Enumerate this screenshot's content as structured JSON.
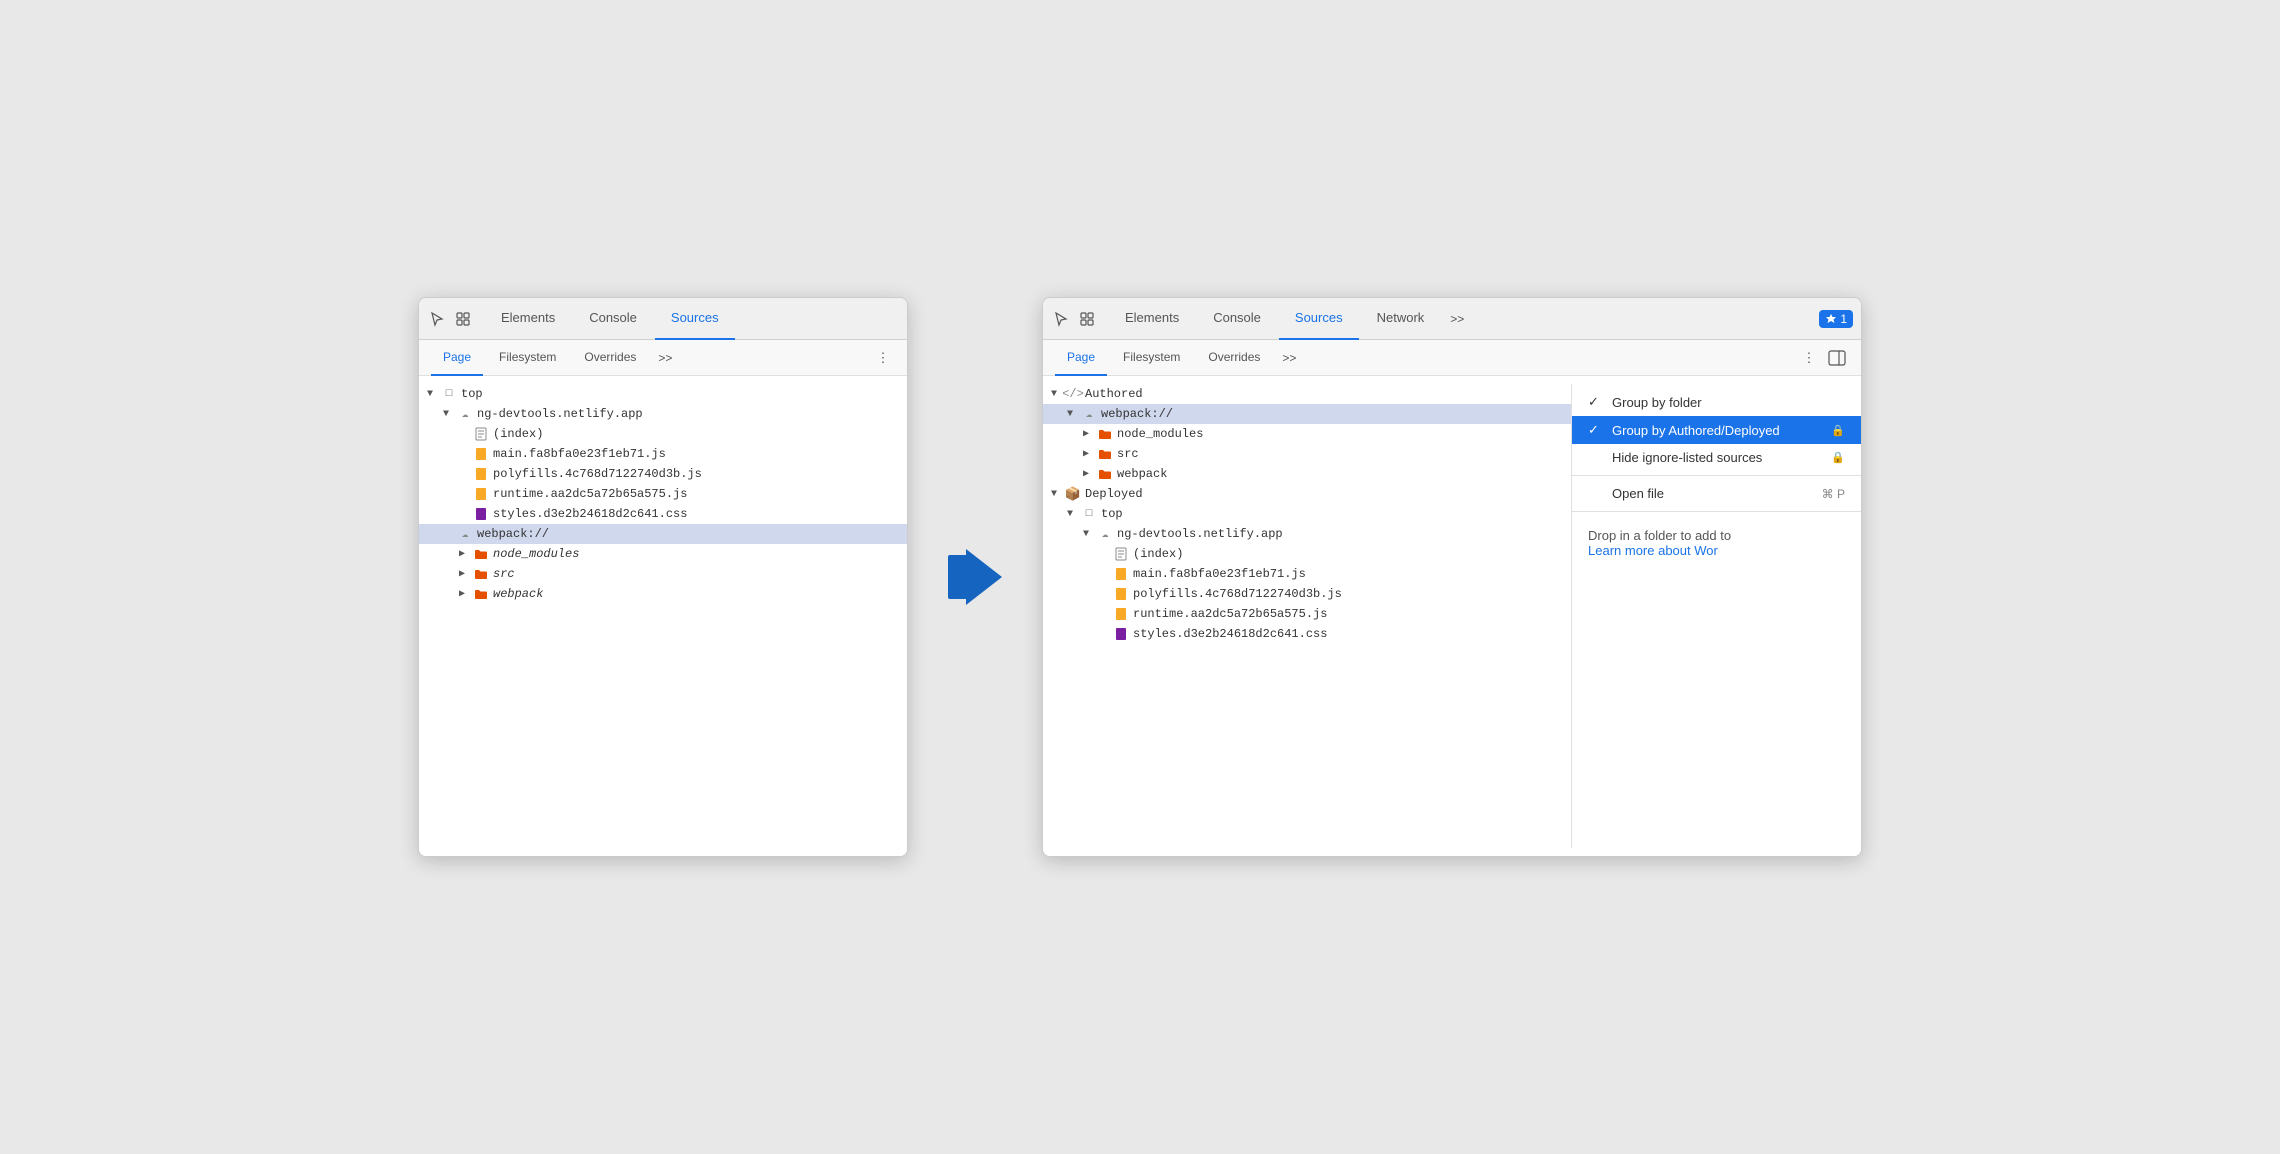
{
  "left_panel": {
    "toolbar": {
      "tabs": [
        "Elements",
        "Console",
        "Sources"
      ],
      "active_tab": "Sources"
    },
    "sub_toolbar": {
      "tabs": [
        "Page",
        "Filesystem",
        "Overrides"
      ],
      "active_tab": "Page",
      "more": ">>"
    },
    "tree": [
      {
        "level": 0,
        "type": "arrow-open",
        "icon": "square",
        "label": "top"
      },
      {
        "level": 1,
        "type": "arrow-open",
        "icon": "cloud",
        "label": "ng-devtools.netlify.app"
      },
      {
        "level": 2,
        "type": "none",
        "icon": "page",
        "label": "(index)"
      },
      {
        "level": 2,
        "type": "none",
        "icon": "js-yellow",
        "label": "main.fa8bfa0e23f1eb71.js"
      },
      {
        "level": 2,
        "type": "none",
        "icon": "js-yellow",
        "label": "polyfills.4c768d7122740d3b.js"
      },
      {
        "level": 2,
        "type": "none",
        "icon": "js-yellow",
        "label": "runtime.aa2dc5a72b65a575.js"
      },
      {
        "level": 2,
        "type": "none",
        "icon": "css-purple",
        "label": "styles.d3e2b24618d2c641.css"
      },
      {
        "level": 1,
        "type": "none",
        "icon": "cloud",
        "label": "webpack://",
        "highlighted": true
      },
      {
        "level": 2,
        "type": "arrow-closed",
        "icon": "folder-orange",
        "label": "node_modules"
      },
      {
        "level": 2,
        "type": "arrow-closed",
        "icon": "folder-orange",
        "label": "src"
      },
      {
        "level": 2,
        "type": "arrow-closed",
        "icon": "folder-orange",
        "label": "webpack"
      }
    ]
  },
  "right_panel": {
    "toolbar": {
      "tabs": [
        "Elements",
        "Console",
        "Sources",
        "Network"
      ],
      "active_tab": "Sources",
      "more": ">>",
      "badge": "1"
    },
    "sub_toolbar": {
      "tabs": [
        "Page",
        "Filesystem",
        "Overrides"
      ],
      "active_tab": "Page",
      "more": ">>"
    },
    "tree": [
      {
        "level": 0,
        "type": "arrow-open",
        "icon": "code",
        "label": "Authored"
      },
      {
        "level": 1,
        "type": "arrow-open",
        "icon": "cloud",
        "label": "webpack://",
        "highlighted": true
      },
      {
        "level": 2,
        "type": "arrow-closed",
        "icon": "folder-orange",
        "label": "node_modules"
      },
      {
        "level": 2,
        "type": "arrow-closed",
        "icon": "folder-orange",
        "label": "src"
      },
      {
        "level": 2,
        "type": "arrow-closed",
        "icon": "folder-orange",
        "label": "webpack"
      },
      {
        "level": 0,
        "type": "arrow-open",
        "icon": "box",
        "label": "Deployed"
      },
      {
        "level": 1,
        "type": "arrow-open",
        "icon": "square",
        "label": "top"
      },
      {
        "level": 2,
        "type": "arrow-open",
        "icon": "cloud",
        "label": "ng-devtools.netlify.app"
      },
      {
        "level": 3,
        "type": "none",
        "icon": "page",
        "label": "(index)"
      },
      {
        "level": 3,
        "type": "none",
        "icon": "js-yellow",
        "label": "main.fa8bfa0e23f1eb71.js"
      },
      {
        "level": 3,
        "type": "none",
        "icon": "js-yellow",
        "label": "polyfills.4c768d7122740d3b.js"
      },
      {
        "level": 3,
        "type": "none",
        "icon": "js-yellow",
        "label": "runtime.aa2dc5a72b65a575.js"
      },
      {
        "level": 3,
        "type": "none",
        "icon": "css-purple",
        "label": "styles.d3e2b24618d2c641.css"
      }
    ],
    "context_menu": {
      "items": [
        {
          "check": "✓",
          "label": "Group by folder",
          "active": false,
          "icon_right": ""
        },
        {
          "check": "✓",
          "label": "Group by Authored/Deployed",
          "active": true,
          "icon_right": "🔒"
        },
        {
          "check": "",
          "label": "Hide ignore-listed sources",
          "active": false,
          "icon_right": "🔒"
        },
        {
          "divider": true
        },
        {
          "check": "",
          "label": "Open file",
          "active": false,
          "shortcut": "⌘ P"
        }
      ]
    },
    "filesystem": {
      "drop_text": "Drop in a folder to add to",
      "learn_link": "Learn more about Wor"
    }
  },
  "labels": {
    "elements": "Elements",
    "console": "Console",
    "sources": "Sources",
    "network": "Network",
    "page": "Page",
    "filesystem": "Filesystem",
    "overrides": "Overrides",
    "more": ">>",
    "more2": "⋮"
  }
}
